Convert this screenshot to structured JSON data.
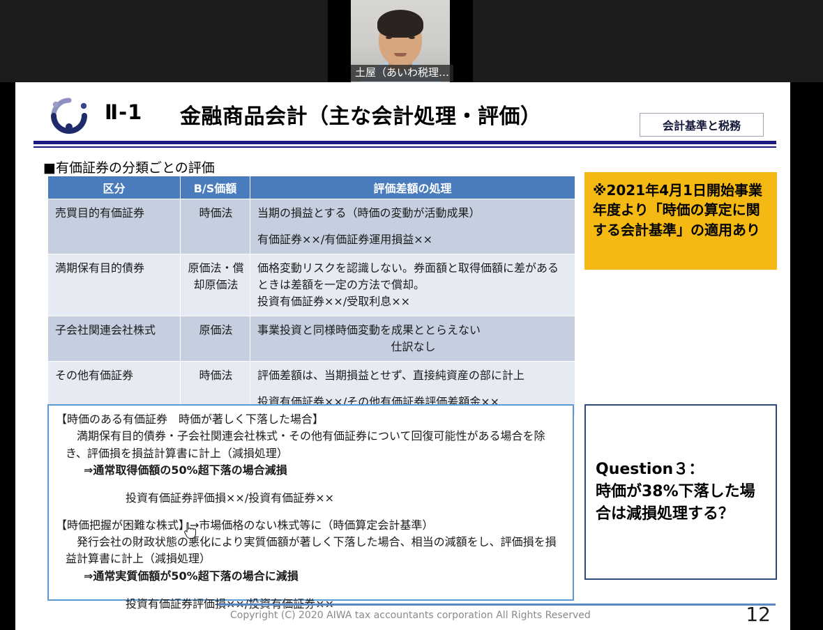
{
  "video": {
    "participant_name": "土屋（あいわ税理…"
  },
  "slide": {
    "section_number": "Ⅱ-1",
    "title": "金融商品会計（主な会計処理・評価）",
    "category_badge": "会計基準と税務",
    "section_heading": "■有価証券の分類ごとの評価",
    "table": {
      "headers": [
        "区分",
        "B/S価額",
        "評価差額の処理"
      ],
      "rows": [
        {
          "category": "売買目的有価証券",
          "bs_value": "時価法",
          "treatment_line1": "当期の損益とする（時価の変動が活動成果）",
          "treatment_line2": "有価証券××/有価証券運用損益××"
        },
        {
          "category": "満期保有目的債券",
          "bs_value": "原価法・償却原価法",
          "treatment_line1": "価格変動リスクを認識しない。券面額と取得価額に差があるときは差額を一定の方法で償却。",
          "treatment_line2": "投資有価証券××/受取利息××"
        },
        {
          "category": "子会社関連会社株式",
          "bs_value": "原価法",
          "treatment_line1": "事業投資と同様時価変動を成果ととらえない",
          "treatment_line2": "仕訳なし"
        },
        {
          "category": "その他有価証券",
          "bs_value": "時価法",
          "treatment_line1": "評価差額は、当期損益とせず、直接純資産の部に計上",
          "treatment_line2": "投資有価証券××/その他有価証券評価差額金××"
        }
      ]
    },
    "yellow_note": "※2021年4月1日開始事業年度より「時価の算定に関する会計基準」の適用あり",
    "detail_box": {
      "heading1": "【時価のある有価証券　時価が著しく下落した場合】",
      "body1": "　満期保有目的債券・子会社関連会社株式・その他有価証券について回復可能性がある場合を除き、評価損を損益計算書に計上（減損処理）",
      "arrow1": "⇒通常取得価額の50%超下落の場合減損",
      "entry1": "投資有価証券評価損××/投資有価証券××",
      "heading2": "【時価把握が困難な株式】→市場価格のない株式等に（時価算定会計基準）",
      "body2": "　発行会社の財政状態の悪化により実質価額が著しく下落した場合、相当の減額をし、評価損を損益計算書に計上（減損処理）",
      "arrow2": "⇒通常実質価額が50%超下落の場合に減損",
      "entry2": "投資有価証券評価損××/投資有価証券××"
    },
    "question_box": "Question３：\n時価が38%下落した場合は減損処理する？",
    "footer": {
      "copyright": "Copyright (C) 2020 AIWA tax accountants corporation All Rights Reserved",
      "page_number": "12"
    }
  },
  "colors": {
    "table_header_blue": "#4a7cbd",
    "row_shade_dark": "#c6cfe0",
    "row_shade_light": "#e6eaf3",
    "yellow_note_bg": "#f5b914",
    "title_rule_navy": "#1a1a80",
    "detail_border_blue": "#5b9bd5",
    "question_border_navy": "#2d4a7a"
  }
}
